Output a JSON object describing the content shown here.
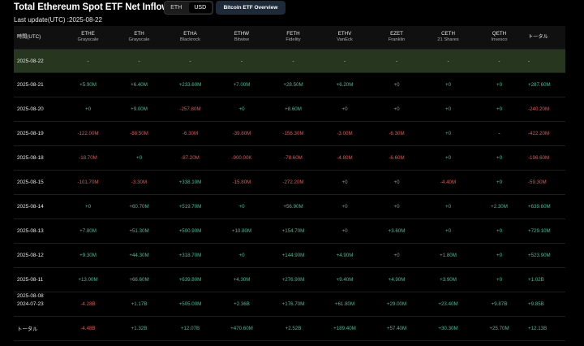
{
  "header": {
    "title": "Total Ethereum Spot ETF Net Inflow USD",
    "toggle": [
      "ETH",
      "USD"
    ],
    "toggle_active": "USD",
    "overview_button": "Bitcoin ETF Overview",
    "last_update": "Last update(UTC) :2025-08-22"
  },
  "table": {
    "date_header": "時間(UTC)",
    "total_header": "トータル",
    "columns": [
      {
        "symbol": "ETHE",
        "issuer": "Grayscale"
      },
      {
        "symbol": "ETH",
        "issuer": "Grayscale"
      },
      {
        "symbol": "ETHA",
        "issuer": "Blackrock"
      },
      {
        "symbol": "ETHW",
        "issuer": "Bitwise"
      },
      {
        "symbol": "FETH",
        "issuer": "Fidelity"
      },
      {
        "symbol": "ETHV",
        "issuer": "VanEck"
      },
      {
        "symbol": "EZET",
        "issuer": "Franklin"
      },
      {
        "symbol": "CETH",
        "issuer": "21 Shares"
      },
      {
        "symbol": "QETH",
        "issuer": "Invesco"
      }
    ],
    "rows": [
      {
        "date": "2025-08-22",
        "values": [
          "-",
          "-",
          "-",
          "-",
          "-",
          "-",
          "-",
          "-",
          "-"
        ],
        "total": "-",
        "highlight": true
      },
      {
        "date": "2025-08-21",
        "values": [
          "+5.90M",
          "+6.40M",
          "+233.60M",
          "+7.00M",
          "+28.50M",
          "+6.20M",
          "+0",
          "+0",
          "+0"
        ],
        "total": "+287.60M"
      },
      {
        "date": "2025-08-20",
        "values": [
          "+0",
          "+9.00M",
          "-257.80M",
          "+0",
          "+8.60M",
          "+0",
          "+0",
          "+0",
          "+0"
        ],
        "total": "-240.20M"
      },
      {
        "date": "2025-08-19",
        "values": [
          "-122.00M",
          "-88.50M",
          "-6.30M",
          "-39.80M",
          "-156.30M",
          "-3.00M",
          "-6.30M",
          "+0",
          "-"
        ],
        "total": "-422.20M"
      },
      {
        "date": "2025-08-18",
        "values": [
          "-18.70M",
          "+0",
          "-87.20M",
          "-900.00K",
          "-78.60M",
          "-4.80M",
          "-6.60M",
          "+0",
          "+0"
        ],
        "total": "-196.60M"
      },
      {
        "date": "2025-08-15",
        "values": [
          "-101.70M",
          "-3.30M",
          "+338.10M",
          "-15.80M",
          "-272.20M",
          "+0",
          "+0",
          "-4.40M",
          "+0"
        ],
        "total": "-59.30M"
      },
      {
        "date": "2025-08-14",
        "values": [
          "+0",
          "+60.70M",
          "+519.70M",
          "+0",
          "+56.90M",
          "+0",
          "+0",
          "+0",
          "+2.30M"
        ],
        "total": "+639.60M"
      },
      {
        "date": "2025-08-13",
        "values": [
          "+7.80M",
          "+51.30M",
          "+500.90M",
          "+10.80M",
          "+154.70M",
          "+0",
          "+3.60M",
          "+0",
          "+0"
        ],
        "total": "+729.10M"
      },
      {
        "date": "2025-08-12",
        "values": [
          "+9.30M",
          "+44.30M",
          "+318.70M",
          "+0",
          "+144.90M",
          "+4.90M",
          "+0",
          "+1.80M",
          "+0"
        ],
        "total": "+523.90M"
      },
      {
        "date": "2025-08-11",
        "values": [
          "+13.00M",
          "+66.60M",
          "+639.80M",
          "+4.30M",
          "+276.90M",
          "+9.40M",
          "+4.90M",
          "+3.90M",
          "+0"
        ],
        "total": "+1.02B"
      },
      {
        "date": "2025-08-08",
        "date2": "2024-07-23",
        "values": [
          "-4.28B",
          "+1.17B",
          "+505.00M",
          "+2.36B",
          "+176.70M",
          "+61.80M",
          "+29.00M",
          "+23.40M",
          "+9.87B"
        ],
        "total": "+9.85B"
      },
      {
        "date": "トータル",
        "values": [
          "-4.48B",
          "+1.32B",
          "+12.07B",
          "+470.60M",
          "+2.52B",
          "+189.40M",
          "+57.40M",
          "+30.30M",
          "+25.70M"
        ],
        "total": "+12.13B"
      }
    ],
    "colors": {
      "positive": "#3fbf93",
      "negative": "#e55454",
      "highlight_row": "#27361e"
    }
  }
}
